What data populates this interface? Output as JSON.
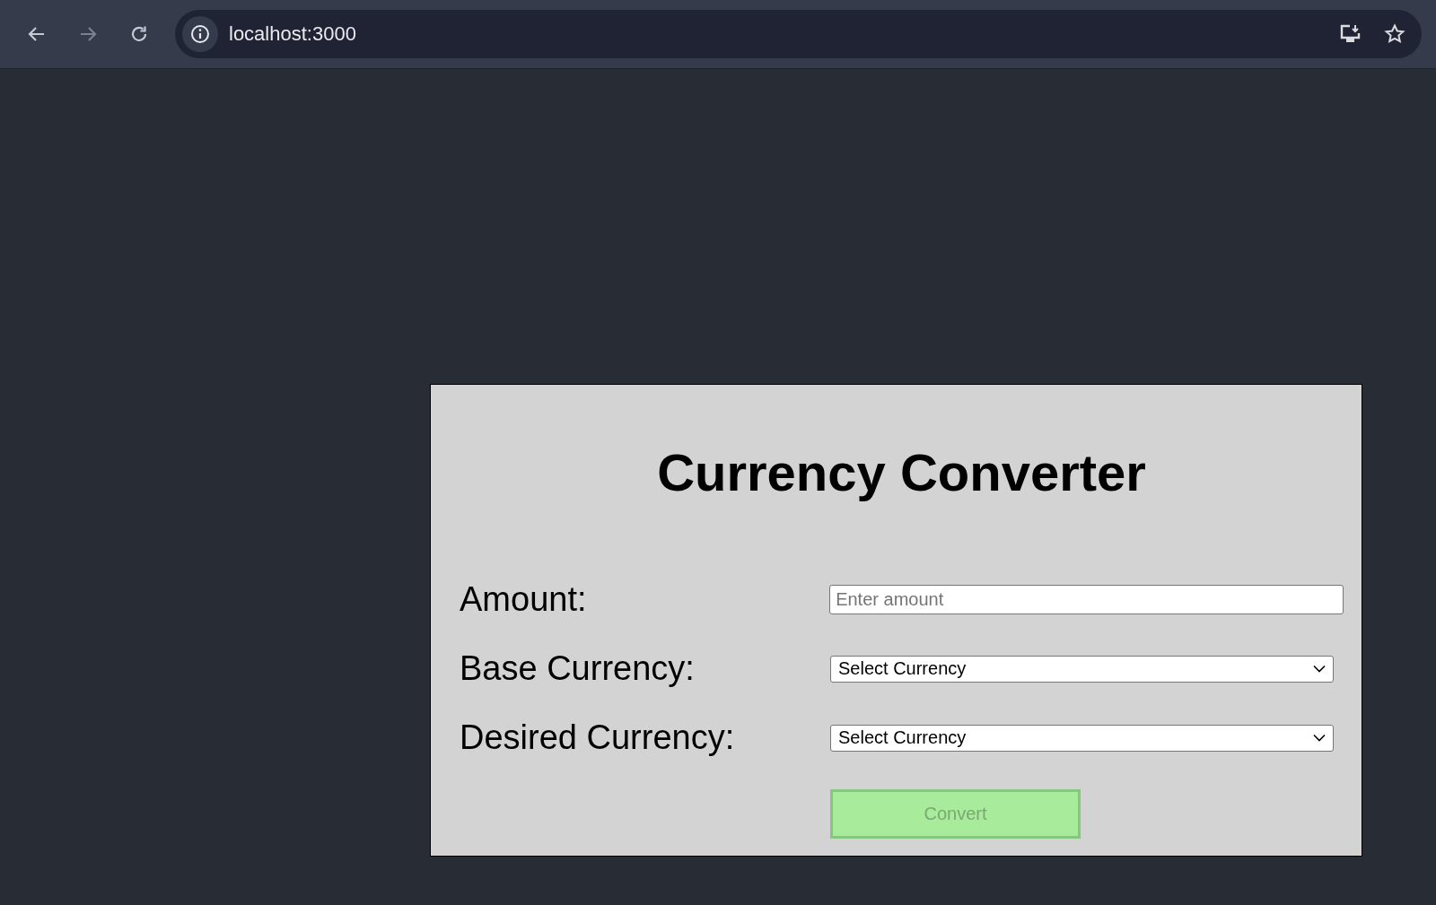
{
  "browser": {
    "nav_buttons": [
      {
        "kind": "back",
        "disabled": false
      },
      {
        "kind": "forward",
        "disabled": true
      },
      {
        "kind": "reload",
        "disabled": false
      }
    ],
    "url": "localhost:3000"
  },
  "converter": {
    "title": "Currency Converter",
    "fields": [
      {
        "kind": "input",
        "label": "Amount:",
        "placeholder": "Enter amount"
      },
      {
        "kind": "select",
        "label": "Base Currency:",
        "value": "Select Currency"
      },
      {
        "kind": "select",
        "label": "Desired Currency:",
        "value": "Select Currency"
      }
    ],
    "button": {
      "label": "Convert",
      "disabled": true
    }
  }
}
